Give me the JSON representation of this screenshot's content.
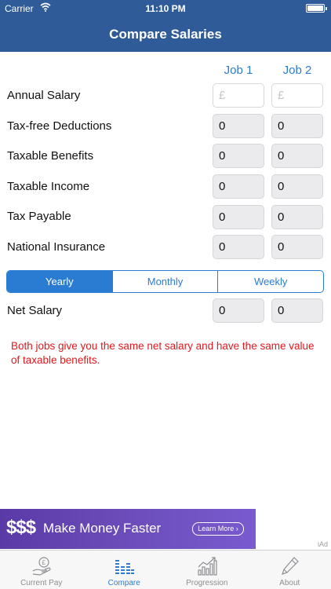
{
  "status_bar": {
    "carrier": "Carrier",
    "time": "11:10 PM"
  },
  "nav": {
    "title": "Compare Salaries"
  },
  "columns": {
    "job1": "Job 1",
    "job2": "Job 2"
  },
  "rows": [
    {
      "label": "Annual Salary",
      "job1": "£",
      "job2": "£"
    },
    {
      "label": "Tax-free Deductions",
      "job1": "0",
      "job2": "0"
    },
    {
      "label": "Taxable Benefits",
      "job1": "0",
      "job2": "0"
    },
    {
      "label": "Taxable Income",
      "job1": "0",
      "job2": "0"
    },
    {
      "label": "Tax Payable",
      "job1": "0",
      "job2": "0"
    },
    {
      "label": "National Insurance",
      "job1": "0",
      "job2": "0"
    }
  ],
  "period": {
    "options": [
      "Yearly",
      "Monthly",
      "Weekly"
    ],
    "selected": "Yearly"
  },
  "net_salary": {
    "label": "Net Salary",
    "job1": "0",
    "job2": "0"
  },
  "message": "Both jobs give you the same net salary and have the same value of taxable benefits.",
  "ad": {
    "symbol": "$$$",
    "text": "Make Money Faster",
    "button": "Learn More ›",
    "badge": "iAd"
  },
  "tabs": [
    {
      "label": "Current Pay",
      "icon": "hand-pound-icon"
    },
    {
      "label": "Compare",
      "icon": "bars-icon",
      "active": true
    },
    {
      "label": "Progression",
      "icon": "chart-icon"
    },
    {
      "label": "About",
      "icon": "pen-icon"
    }
  ],
  "colors": {
    "nav": "#2f5b99",
    "accent": "#2a7cd3",
    "message": "#e0191e"
  }
}
